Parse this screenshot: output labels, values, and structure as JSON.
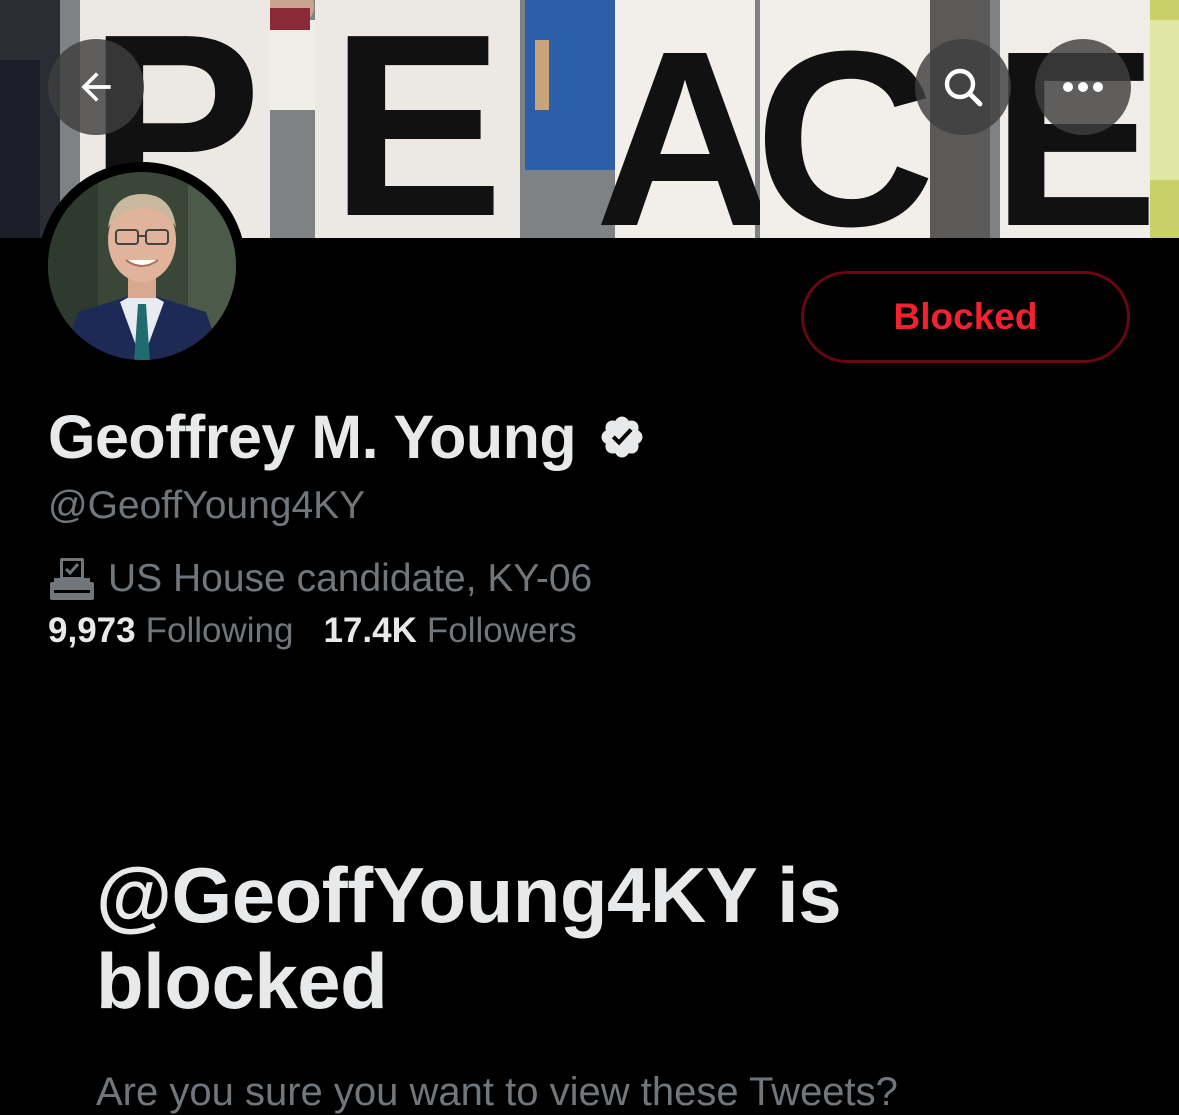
{
  "header": {
    "back_icon": "arrow-left-icon",
    "search_icon": "search-icon",
    "more_icon": "more-horizontal-icon"
  },
  "banner": {
    "sign_letters": [
      "P",
      "E",
      "A",
      "C",
      "E"
    ],
    "description": "protest banner"
  },
  "profile": {
    "display_name": "Geoffrey M. Young",
    "verified_icon": "verified-badge-icon",
    "handle": "@GeoffYoung4KY",
    "bio_icon": "ballot-box-icon",
    "bio": "US House candidate, KY-06",
    "following_count": "9,973",
    "following_label": "Following",
    "followers_count": "17.4K",
    "followers_label": "Followers",
    "blocked_button_label": "Blocked"
  },
  "notice": {
    "title": "@GeoffYoung4KY is blocked",
    "subtitle": "Are you sure you want to view these Tweets?"
  },
  "colors": {
    "background": "#000000",
    "primary_text": "#e7e9ea",
    "secondary_text": "#71767b",
    "danger": "#f4212e",
    "danger_border": "#67070f"
  }
}
